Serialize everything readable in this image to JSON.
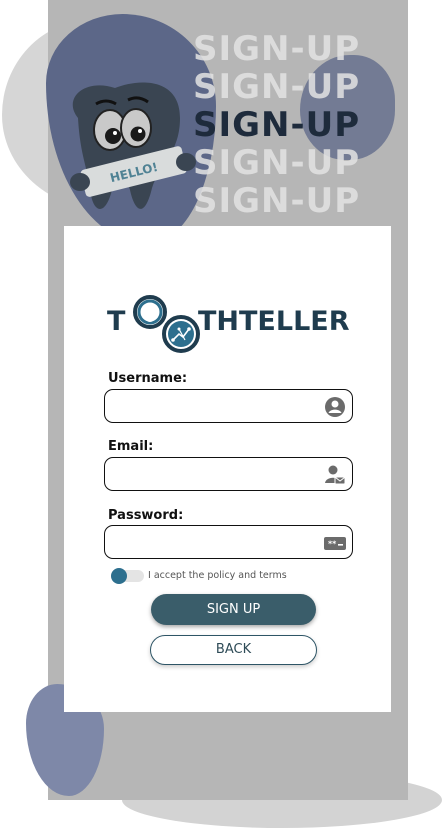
{
  "hero": {
    "title_lines": [
      "SIGN-UP",
      "SIGN-UP",
      "SIGN-UP",
      "SIGN-UP",
      "SIGN-UP"
    ],
    "mascot_sign": "HELLO!"
  },
  "logo": {
    "prefix": "T",
    "suffix": "THTELLER",
    "icons": [
      "tooth-o-icon",
      "circuit-o-icon"
    ]
  },
  "form": {
    "username": {
      "label": "Username:",
      "value": "",
      "placeholder": "",
      "icon": "user-circle-icon"
    },
    "email": {
      "label": "Email:",
      "value": "",
      "placeholder": "",
      "icon": "user-mail-icon"
    },
    "password": {
      "label": "Password:",
      "value": "",
      "placeholder": "",
      "icon": "password-dots-icon"
    },
    "terms": {
      "label": "I accept the policy and terms",
      "checked": false
    }
  },
  "actions": {
    "signup_label": "SIGN UP",
    "back_label": "BACK"
  },
  "colors": {
    "primary": "#3a5d6a",
    "accent_blue": "#2d6f8e",
    "navy": "#1f3c4e",
    "panel_gray": "#b6b6b6"
  }
}
